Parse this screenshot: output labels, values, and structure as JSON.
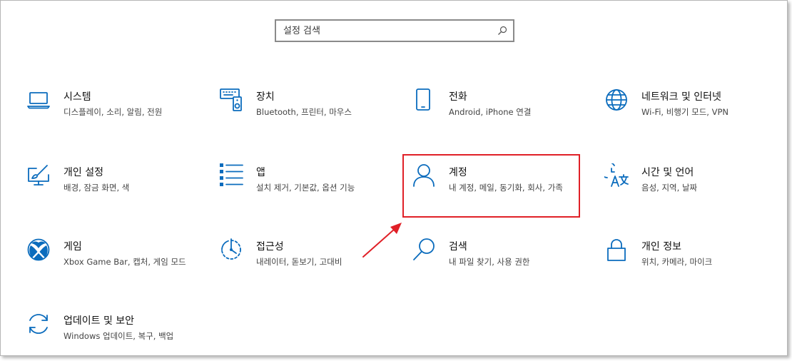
{
  "search": {
    "placeholder": "설정 검색",
    "value": ""
  },
  "settings": [
    {
      "key": "system",
      "title": "시스템",
      "desc": "디스플레이, 소리, 알림, 전원",
      "icon": "laptop-icon"
    },
    {
      "key": "devices",
      "title": "장치",
      "desc": "Bluetooth, 프린터, 마우스",
      "icon": "keyboard-speaker-icon"
    },
    {
      "key": "phone",
      "title": "전화",
      "desc": "Android, iPhone 연결",
      "icon": "phone-icon"
    },
    {
      "key": "network",
      "title": "네트워크 및 인터넷",
      "desc": "Wi-Fi, 비행기 모드, VPN",
      "icon": "globe-icon"
    },
    {
      "key": "personalization",
      "title": "개인 설정",
      "desc": "배경, 잠금 화면, 색",
      "icon": "paint-monitor-icon"
    },
    {
      "key": "apps",
      "title": "앱",
      "desc": "설치 제거, 기본값, 옵션 기능",
      "icon": "app-list-icon"
    },
    {
      "key": "accounts",
      "title": "계정",
      "desc": "내 계정, 메일, 동기화, 회사, 가족",
      "icon": "person-icon"
    },
    {
      "key": "time-language",
      "title": "시간 및 언어",
      "desc": "음성, 지역, 날짜",
      "icon": "language-icon"
    },
    {
      "key": "gaming",
      "title": "게임",
      "desc": "Xbox Game Bar, 캡처, 게임 모드",
      "icon": "xbox-icon"
    },
    {
      "key": "ease-of-access",
      "title": "접근성",
      "desc": "내레이터, 돋보기, 고대비",
      "icon": "ease-of-access-icon"
    },
    {
      "key": "search",
      "title": "검색",
      "desc": "내 파일 찾기, 사용 권한",
      "icon": "magnifier-icon"
    },
    {
      "key": "privacy",
      "title": "개인 정보",
      "desc": "위치, 카메라, 마이크",
      "icon": "lock-icon"
    },
    {
      "key": "update",
      "title": "업데이트 및 보안",
      "desc": "Windows 업데이트, 복구, 백업",
      "icon": "sync-icon"
    }
  ],
  "colors": {
    "accent": "#0b6cbd",
    "highlight": "#e02027"
  }
}
